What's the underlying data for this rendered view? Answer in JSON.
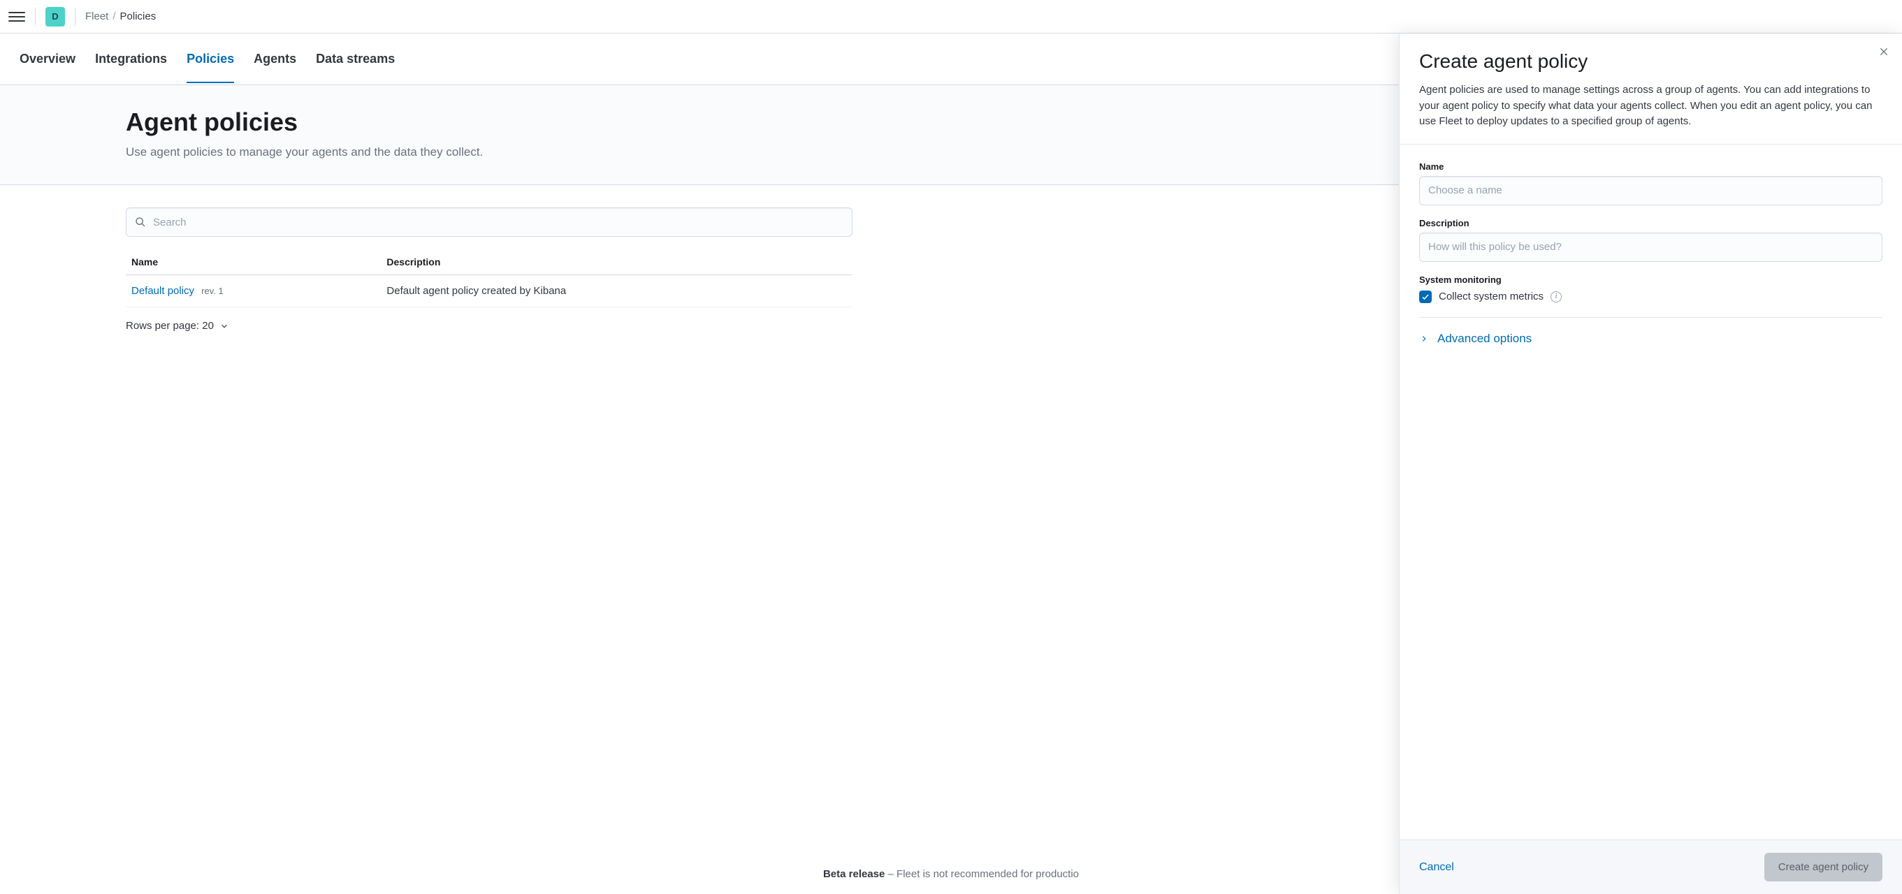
{
  "header": {
    "app_initial": "D",
    "breadcrumb_parent": "Fleet",
    "breadcrumb_current": "Policies"
  },
  "tabs": [
    {
      "label": "Overview",
      "active": false
    },
    {
      "label": "Integrations",
      "active": false
    },
    {
      "label": "Policies",
      "active": true
    },
    {
      "label": "Agents",
      "active": false
    },
    {
      "label": "Data streams",
      "active": false
    }
  ],
  "page": {
    "title": "Agent policies",
    "subtitle": "Use agent policies to manage your agents and the data they collect."
  },
  "search": {
    "placeholder": "Search"
  },
  "table": {
    "columns": [
      "Name",
      "Description"
    ],
    "rows": [
      {
        "name": "Default policy",
        "rev": "rev. 1",
        "description": "Default agent policy created by Kibana"
      }
    ]
  },
  "pagination": {
    "rows_per_page_label": "Rows per page: 20"
  },
  "footer": {
    "beta_label": "Beta release",
    "beta_text": " – Fleet is not recommended for productio"
  },
  "flyout": {
    "title": "Create agent policy",
    "description": "Agent policies are used to manage settings across a group of agents. You can add integrations to your agent policy to specify what data your agents collect. When you edit an agent policy, you can use Fleet to deploy updates to a specified group of agents.",
    "name_label": "Name",
    "name_placeholder": "Choose a name",
    "description_label": "Description",
    "description_placeholder": "How will this policy be used?",
    "system_monitoring_label": "System monitoring",
    "collect_metrics_label": "Collect system metrics",
    "advanced_options_label": "Advanced options",
    "cancel_label": "Cancel",
    "submit_label": "Create agent policy"
  }
}
